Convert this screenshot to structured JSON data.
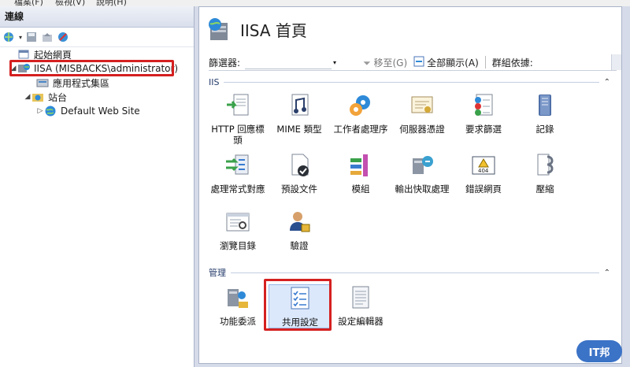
{
  "menubar": {
    "file": "檔案(F)",
    "view": "檢視(V)",
    "help": "說明(H)"
  },
  "connections": {
    "title": "連線",
    "tree": [
      {
        "label": "起始網頁",
        "level": 1
      },
      {
        "label": "IISA (MISBACKS\\administrator)",
        "level": 1
      },
      {
        "label": "應用程式集區",
        "level": 2
      },
      {
        "label": "站台",
        "level": 2
      },
      {
        "label": "Default Web Site",
        "level": 3
      }
    ]
  },
  "main": {
    "title": "IISA 首頁",
    "filter": {
      "label": "篩選器:",
      "go": "移至(G)",
      "show_all": "全部顯示(A)",
      "group_by": "群組依據:"
    },
    "groups": [
      {
        "name": "IIS",
        "items": [
          {
            "label": "HTTP 回應標頭",
            "icon": "http-response-icon"
          },
          {
            "label": "MIME 類型",
            "icon": "mime-icon"
          },
          {
            "label": "工作者處理序",
            "icon": "worker-process-icon"
          },
          {
            "label": "伺服器憑證",
            "icon": "certificate-icon"
          },
          {
            "label": "要求篩選",
            "icon": "request-filter-icon"
          },
          {
            "label": "記錄",
            "icon": "logging-icon"
          },
          {
            "label": "處理常式對應",
            "icon": "handler-mapping-icon"
          },
          {
            "label": "預設文件",
            "icon": "default-document-icon"
          },
          {
            "label": "模組",
            "icon": "modules-icon"
          },
          {
            "label": "輸出快取處理",
            "icon": "output-cache-icon"
          },
          {
            "label": "錯誤網頁",
            "icon": "error-pages-icon"
          },
          {
            "label": "壓縮",
            "icon": "compression-icon"
          },
          {
            "label": "瀏覽目錄",
            "icon": "directory-browsing-icon"
          },
          {
            "label": "驗證",
            "icon": "authentication-icon"
          }
        ]
      },
      {
        "name": "管理",
        "items": [
          {
            "label": "功能委派",
            "icon": "feature-delegation-icon"
          },
          {
            "label": "共用設定",
            "icon": "shared-configuration-icon",
            "selected": true
          },
          {
            "label": "設定編輯器",
            "icon": "configuration-editor-icon"
          }
        ]
      }
    ]
  },
  "watermark": "IT邦"
}
